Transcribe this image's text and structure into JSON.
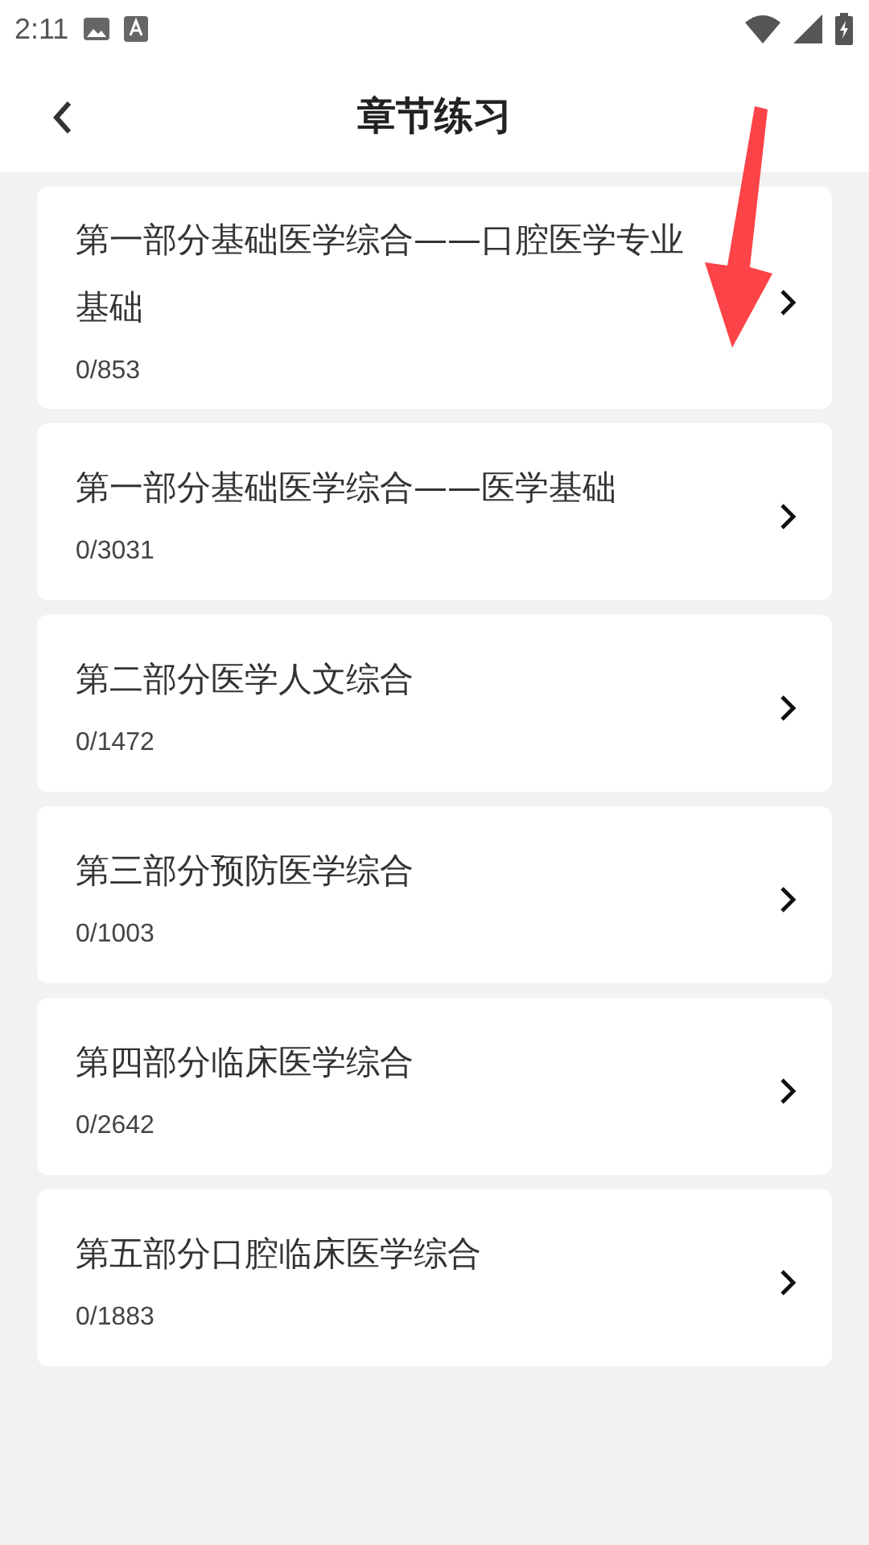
{
  "status_bar": {
    "time": "2:11"
  },
  "header": {
    "title": "章节练习"
  },
  "chapters": [
    {
      "title": "第一部分基础医学综合——口腔医学专业基础",
      "progress": "0/853"
    },
    {
      "title": "第一部分基础医学综合——医学基础",
      "progress": "0/3031"
    },
    {
      "title": "第二部分医学人文综合",
      "progress": "0/1472"
    },
    {
      "title": "第三部分预防医学综合",
      "progress": "0/1003"
    },
    {
      "title": "第四部分临床医学综合",
      "progress": "0/2642"
    },
    {
      "title": "第五部分口腔临床医学综合",
      "progress": "0/1883"
    }
  ]
}
